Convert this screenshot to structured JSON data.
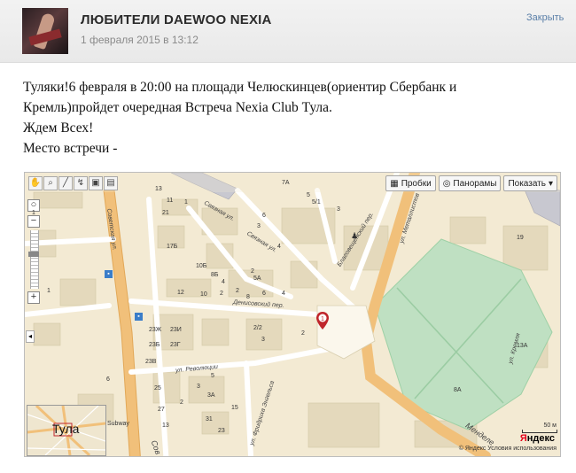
{
  "header": {
    "title": "ЛЮБИТЕЛИ DAEWOO NEXIA",
    "date": "1 февраля 2015 в 13:12",
    "close_label": "Закрыть"
  },
  "post": {
    "lines": [
      "Туляки!6 февраля в 20:00 на площади Челюскинцев(ориентир Сбербанк и Кремль)пройдет очередная Встреча Nexia Club Тула.",
      "Ждем Всех!",
      "Место встречи -"
    ]
  },
  "map": {
    "buttons": {
      "traffic": "Пробки",
      "panoramas": "Панорамы",
      "show": "Показать"
    },
    "streets": {
      "sovetskaya": "Советская ул.",
      "sovetskaya_bottom": "Сов",
      "svyaznaya1": "Связная ул.",
      "svyaznaya2": "Связная ул.",
      "blagoveshchensky": "Благовещенский пер.",
      "metallistov": "ул. Металлистов",
      "denisovsky": "Денисовский пер.",
      "revolyutsii": "ул. Революции",
      "fridriha_engelsa": "ул. Фридриха Энгельса",
      "kremlya": "ул. Кремля",
      "mendeleevskaya": "Менделе"
    },
    "house_numbers": [
      "13",
      "11",
      "7А",
      "5",
      "5/1",
      "3",
      "1",
      "21",
      "1",
      "3",
      "6",
      "4",
      "17Б",
      "10Б",
      "8Б",
      "5А",
      "4",
      "2",
      "1",
      "12",
      "10",
      "2",
      "8",
      "6",
      "4",
      "2",
      "2/2",
      "3",
      "2",
      "23Ж",
      "23И",
      "23Б",
      "23Г",
      "23В",
      "25",
      "5",
      "3",
      "3А",
      "2",
      "15",
      "27",
      "13",
      "31",
      "23",
      "6",
      "13А",
      "8А",
      "19"
    ],
    "marker_label": "1",
    "minimap_label": "Тула",
    "subway_label": "Subway",
    "scale_label": "50 м",
    "brand": {
      "first": "Я",
      "rest": "ндекс"
    },
    "footer": "© Яндекс Условия использования"
  }
}
